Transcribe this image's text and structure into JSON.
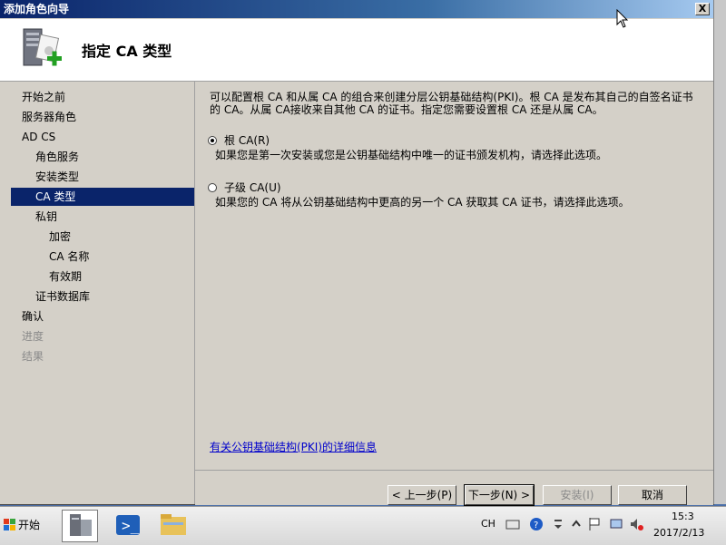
{
  "window": {
    "title": "添加角色向导",
    "close_label": "X",
    "header_title": "指定 CA 类型"
  },
  "nav": {
    "items": [
      {
        "label": "开始之前",
        "level": 0,
        "state": "normal"
      },
      {
        "label": "服务器角色",
        "level": 0,
        "state": "normal"
      },
      {
        "label": "AD CS",
        "level": 0,
        "state": "normal"
      },
      {
        "label": "角色服务",
        "level": 1,
        "state": "normal"
      },
      {
        "label": "安装类型",
        "level": 1,
        "state": "normal"
      },
      {
        "label": "CA 类型",
        "level": 1,
        "state": "selected"
      },
      {
        "label": "私钥",
        "level": 1,
        "state": "normal"
      },
      {
        "label": "加密",
        "level": 2,
        "state": "normal"
      },
      {
        "label": "CA 名称",
        "level": 2,
        "state": "normal"
      },
      {
        "label": "有效期",
        "level": 2,
        "state": "normal"
      },
      {
        "label": "证书数据库",
        "level": 1,
        "state": "normal"
      },
      {
        "label": "确认",
        "level": 0,
        "state": "normal"
      },
      {
        "label": "进度",
        "level": 0,
        "state": "disabled"
      },
      {
        "label": "结果",
        "level": 0,
        "state": "disabled"
      }
    ]
  },
  "content": {
    "description_line1": "可以配置根 CA 和从属 CA 的组合来创建分层公钥基础结构(PKI)。根 CA 是发布其自己的自签名证书",
    "description_line2": "的 CA。从属 CA接收来自其他 CA 的证书。指定您需要设置根 CA 还是从属 CA。",
    "options": [
      {
        "label": "根 CA(R)",
        "description": "如果您是第一次安装或您是公钥基础结构中唯一的证书颁发机构，请选择此选项。",
        "checked": true
      },
      {
        "label": "子级 CA(U)",
        "description": "如果您的 CA 将从公钥基础结构中更高的另一个 CA 获取其 CA 证书，请选择此选项。",
        "checked": false
      }
    ],
    "link": "有关公钥基础结构(PKI)的详细信息"
  },
  "buttons": {
    "back": "< 上一步(P)",
    "next": "下一步(N) >",
    "install": "安装(I)",
    "cancel": "取消"
  },
  "taskbar": {
    "start_label": "开始",
    "language": "CH",
    "icons": [
      "server-manager-icon",
      "powershell-icon",
      "explorer-icon"
    ],
    "tray_icons": [
      "keyboard-icon",
      "help-icon",
      "ime-options-icon",
      "chevron-up-icon",
      "flag-icon",
      "network-icon",
      "volume-icon"
    ],
    "clock_time": "15:3",
    "clock_date": "2017/2/13"
  }
}
